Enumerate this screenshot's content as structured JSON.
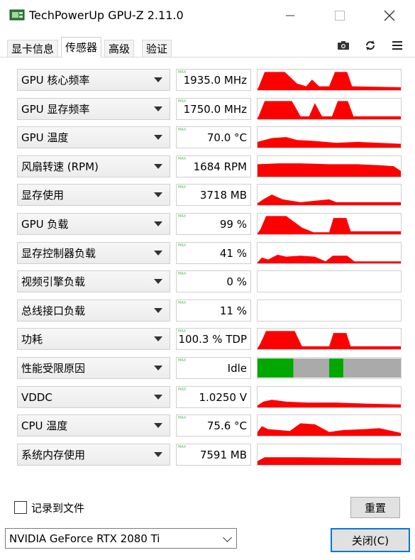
{
  "window": {
    "title": "TechPowerUp GPU-Z 2.11.0",
    "buttons": [
      "minimize-icon",
      "maximize-icon",
      "close-icon"
    ]
  },
  "tabs": [
    {
      "label": "显卡信息",
      "active": false
    },
    {
      "label": "传感器",
      "active": true
    },
    {
      "label": "高级",
      "active": false
    },
    {
      "label": "验证",
      "active": false
    }
  ],
  "toolbar_icons": [
    "camera-icon",
    "refresh-icon",
    "menu-icon"
  ],
  "max_tag": "MAX",
  "sensors": [
    {
      "label": "GPU 核心频率",
      "value": "1935.0 MHz",
      "graph": "red"
    },
    {
      "label": "GPU 显存频率",
      "value": "1750.0 MHz",
      "graph": "red"
    },
    {
      "label": "GPU 温度",
      "value": "70.0 °C",
      "graph": "red"
    },
    {
      "label": "风扇转速 (RPM)",
      "value": "1684 RPM",
      "graph": "red"
    },
    {
      "label": "显存使用",
      "value": "3718 MB",
      "graph": "red"
    },
    {
      "label": "GPU 负载",
      "value": "99 %",
      "graph": "red"
    },
    {
      "label": "显存控制器负载",
      "value": "41 %",
      "graph": "red"
    },
    {
      "label": "视频引擎负载",
      "value": "0 %",
      "graph": "none"
    },
    {
      "label": "总线接口负载",
      "value": "11 %",
      "graph": "none"
    },
    {
      "label": "功耗",
      "value": "100.3 % TDP",
      "graph": "red"
    },
    {
      "label": "性能受限原因",
      "value": "Idle",
      "graph": "perfcap"
    },
    {
      "label": "VDDC",
      "value": "1.0250 V",
      "graph": "red"
    },
    {
      "label": "CPU 温度",
      "value": "75.6 °C",
      "graph": "red"
    },
    {
      "label": "系统内存使用",
      "value": "7591 MB",
      "graph": "red"
    }
  ],
  "colors": {
    "graph_fill": "#ff0000",
    "perfcap_green": "#00a800",
    "perfcap_gray": "#aaaaaa",
    "focus_blue": "#0078d7"
  },
  "log_to_file": {
    "label": "记录到文件",
    "checked": false
  },
  "reset_label": "重置",
  "gpu_select": {
    "value": "NVIDIA GeForce RTX 2080 Ti"
  },
  "close_label": "关闭(C)"
}
